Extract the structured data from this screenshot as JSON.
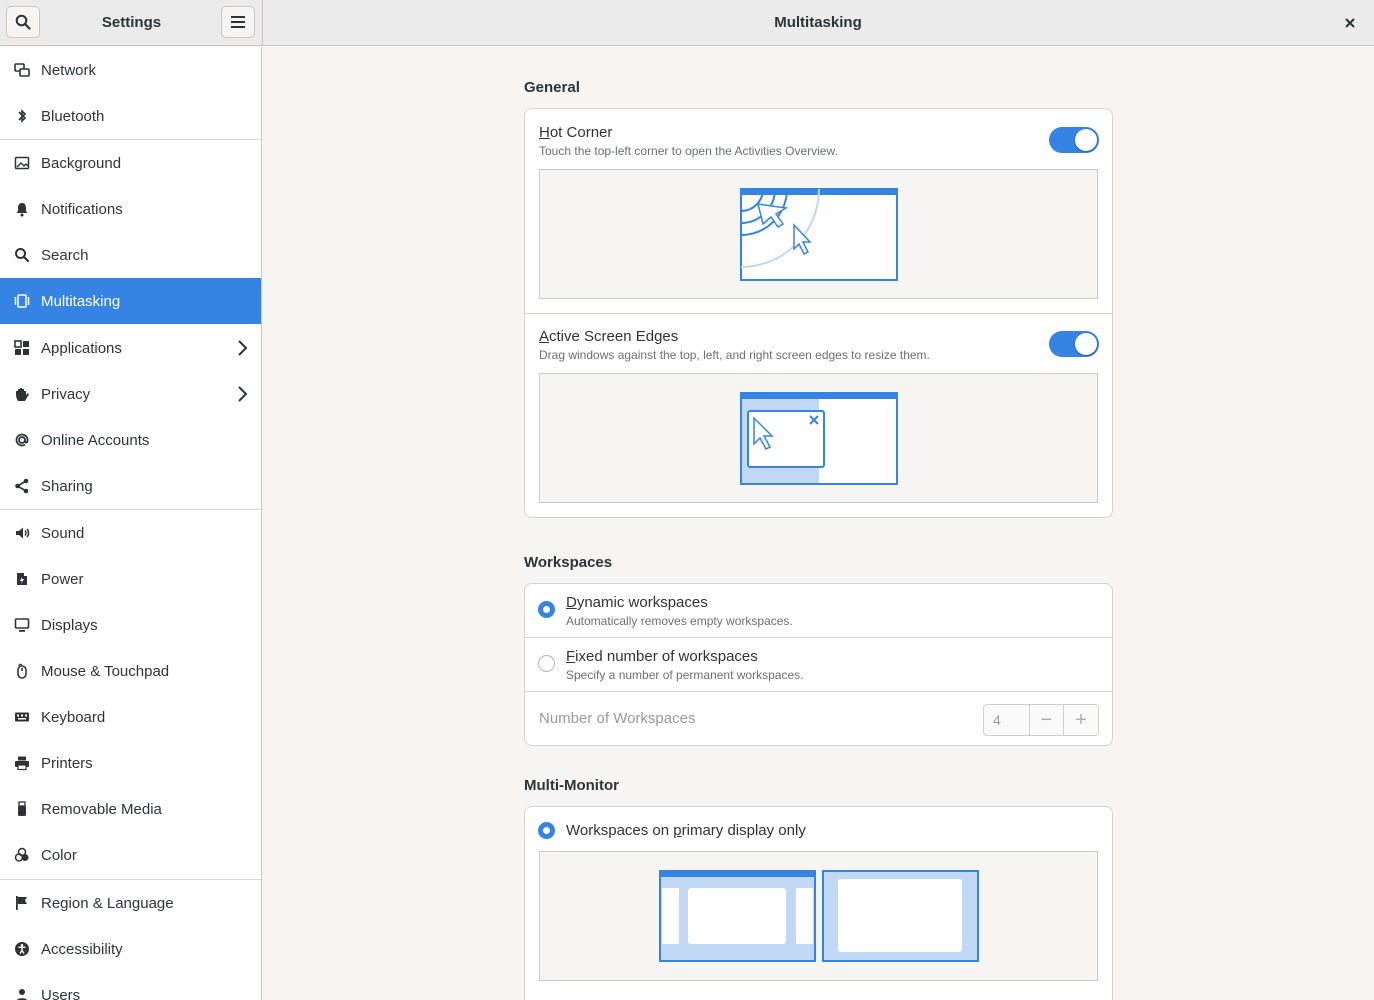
{
  "header": {
    "left_title": "Settings",
    "page_title": "Multitasking"
  },
  "sidebar": {
    "items": [
      {
        "label": "Network",
        "icon": "network-icon"
      },
      {
        "label": "Bluetooth",
        "icon": "bluetooth-icon"
      },
      {
        "label": "Background",
        "icon": "background-icon"
      },
      {
        "label": "Notifications",
        "icon": "bell-icon"
      },
      {
        "label": "Search",
        "icon": "search-icon"
      },
      {
        "label": "Multitasking",
        "icon": "multitasking-icon",
        "active": true
      },
      {
        "label": "Applications",
        "icon": "applications-icon",
        "chevron": true
      },
      {
        "label": "Privacy",
        "icon": "hand-icon",
        "chevron": true
      },
      {
        "label": "Online Accounts",
        "icon": "at-icon"
      },
      {
        "label": "Sharing",
        "icon": "share-icon"
      },
      {
        "label": "Sound",
        "icon": "speaker-icon"
      },
      {
        "label": "Power",
        "icon": "power-icon"
      },
      {
        "label": "Displays",
        "icon": "display-icon"
      },
      {
        "label": "Mouse & Touchpad",
        "icon": "mouse-icon"
      },
      {
        "label": "Keyboard",
        "icon": "keyboard-icon"
      },
      {
        "label": "Printers",
        "icon": "printer-icon"
      },
      {
        "label": "Removable Media",
        "icon": "usb-icon"
      },
      {
        "label": "Color",
        "icon": "color-icon"
      },
      {
        "label": "Region & Language",
        "icon": "flag-icon"
      },
      {
        "label": "Accessibility",
        "icon": "accessibility-icon"
      },
      {
        "label": "Users",
        "icon": "users-icon"
      }
    ]
  },
  "general": {
    "title": "General",
    "hot_corner": {
      "title_first": "H",
      "title_rest": "ot Corner",
      "subtitle": "Touch the top-left corner to open the Activities Overview.",
      "enabled": true
    },
    "edges": {
      "title_first": "A",
      "title_rest": "ctive Screen Edges",
      "subtitle": "Drag windows against the top, left, and right screen edges to resize them.",
      "enabled": true
    }
  },
  "workspaces": {
    "title": "Workspaces",
    "dynamic": {
      "title_first": "D",
      "title_rest": "ynamic workspaces",
      "subtitle": "Automatically removes empty workspaces.",
      "selected": true
    },
    "fixed": {
      "title_first": "F",
      "title_rest": "ixed number of workspaces",
      "subtitle": "Specify a number of permanent workspaces.",
      "selected": false
    },
    "number_label": "Number of Workspaces",
    "number_value": "4",
    "minus": "−",
    "plus": "+"
  },
  "multimonitor": {
    "title": "Multi-Monitor",
    "primary_pre": "Workspaces on ",
    "primary_u": "p",
    "primary_post": "rimary display only",
    "selected": true
  },
  "colors": {
    "accent": "#3584e4",
    "accent_light": "#c0d8f4"
  }
}
